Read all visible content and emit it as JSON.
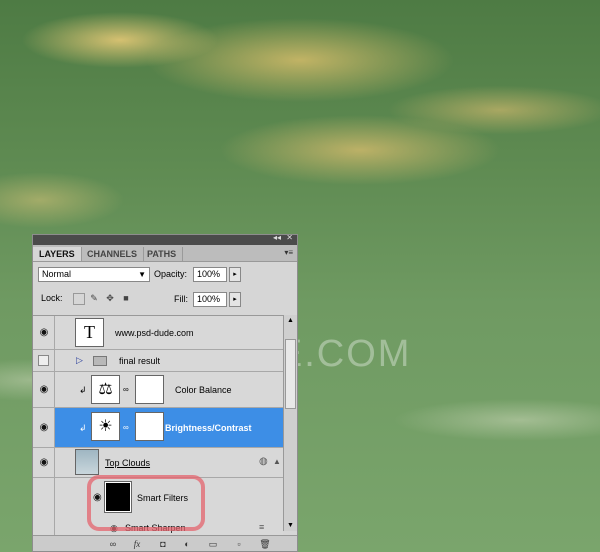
{
  "background": {
    "watermark": "DUDE.COM"
  },
  "panel": {
    "tabs": [
      "LAYERS",
      "CHANNELS",
      "PATHS"
    ],
    "blend_mode": "Normal",
    "opacity_label": "Opacity:",
    "opacity_value": "100%",
    "lock_label": "Lock:",
    "fill_label": "Fill:",
    "fill_value": "100%",
    "layers": [
      {
        "name": "www.psd-dude.com",
        "thumb": "T"
      },
      {
        "name": "final result"
      },
      {
        "name": "Color Balance"
      },
      {
        "name": "Brightness/Contrast"
      },
      {
        "name": "Top Clouds"
      },
      {
        "name": "Smart Filters"
      },
      {
        "name": "Smart Sharpen"
      }
    ]
  },
  "colors": {
    "selection": "#3d8ee6",
    "highlight": "#e4646e",
    "panel": "#d6d6d6"
  },
  "icons": [
    "eye-icon",
    "folder-icon",
    "balance-icon",
    "brightness-icon",
    "link-icon",
    "lock-icon",
    "brush-icon",
    "move-icon",
    "fx-icon",
    "mask-icon",
    "adjustment-icon",
    "new-group-icon",
    "new-layer-icon",
    "trash-icon"
  ]
}
